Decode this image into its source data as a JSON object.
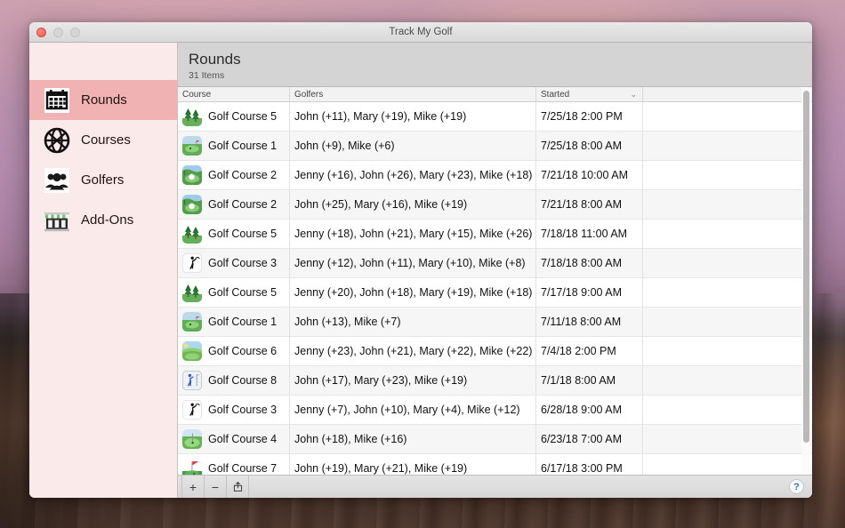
{
  "window": {
    "title": "Track My Golf",
    "traffic_lights": [
      "close",
      "minimize",
      "maximize"
    ]
  },
  "sidebar": {
    "items": [
      {
        "label": "Rounds",
        "icon": "calendar-icon",
        "selected": true
      },
      {
        "label": "Courses",
        "icon": "globe-icon",
        "selected": false
      },
      {
        "label": "Golfers",
        "icon": "people-icon",
        "selected": false
      },
      {
        "label": "Add-Ons",
        "icon": "store-icon",
        "selected": false
      }
    ]
  },
  "content": {
    "title": "Rounds",
    "subtitle": "31 Items"
  },
  "table": {
    "columns": [
      {
        "key": "course",
        "label": "Course",
        "sorted": false
      },
      {
        "key": "golfers",
        "label": "Golfers",
        "sorted": false
      },
      {
        "key": "started",
        "label": "Started",
        "sorted": true,
        "sort_indicator": "⌄"
      },
      {
        "key": "extra",
        "label": "",
        "sorted": false
      }
    ],
    "rows": [
      {
        "course": "Golf Course 5",
        "icon": "course-trees-icon",
        "golfers": "John (+11), Mary (+19), Mike (+19)",
        "started": "7/25/18 2:00 PM"
      },
      {
        "course": "Golf Course 1",
        "icon": "course-green-icon",
        "golfers": "John (+9), Mike (+6)",
        "started": "7/25/18 8:00 AM"
      },
      {
        "course": "Golf Course 2",
        "icon": "course-ball-icon",
        "golfers": "Jenny (+16), John (+26), Mary (+23), Mike (+18)",
        "started": "7/21/18 10:00 AM"
      },
      {
        "course": "Golf Course 2",
        "icon": "course-ball-icon",
        "golfers": "John (+25), Mary (+16), Mike (+19)",
        "started": "7/21/18 8:00 AM"
      },
      {
        "course": "Golf Course 5",
        "icon": "course-trees-icon",
        "golfers": "Jenny (+18), John (+21), Mary (+15), Mike (+26)",
        "started": "7/18/18 11:00 AM"
      },
      {
        "course": "Golf Course 3",
        "icon": "course-swing-icon",
        "golfers": "Jenny (+12), John (+11), Mary (+10), Mike (+8)",
        "started": "7/18/18 8:00 AM"
      },
      {
        "course": "Golf Course 5",
        "icon": "course-trees-icon",
        "golfers": "Jenny (+20), John (+18), Mary (+19), Mike (+18)",
        "started": "7/17/18 9:00 AM"
      },
      {
        "course": "Golf Course 1",
        "icon": "course-green-icon",
        "golfers": "John (+13), Mike (+7)",
        "started": "7/11/18 8:00 AM"
      },
      {
        "course": "Golf Course 6",
        "icon": "course-fairway-icon",
        "golfers": "Jenny (+23), John (+21), Mary (+22), Mike (+22)",
        "started": "7/4/18 2:00 PM"
      },
      {
        "course": "Golf Course 8",
        "icon": "course-golfer-icon",
        "golfers": "John (+17), Mary (+23), Mike (+19)",
        "started": "7/1/18 8:00 AM"
      },
      {
        "course": "Golf Course 3",
        "icon": "course-swing-icon",
        "golfers": "Jenny (+7), John (+10), Mary (+4), Mike (+12)",
        "started": "6/28/18 9:00 AM"
      },
      {
        "course": "Golf Course 4",
        "icon": "course-pin-icon",
        "golfers": "John (+18), Mike (+16)",
        "started": "6/23/18 7:00 AM"
      },
      {
        "course": "Golf Course 7",
        "icon": "course-flag-icon",
        "golfers": "John (+19), Mary (+21), Mike (+19)",
        "started": "6/17/18 3:00 PM"
      },
      {
        "course": "",
        "icon": "course-ball-icon",
        "golfers": "",
        "started": ""
      }
    ]
  },
  "toolbar": {
    "add_label": "+",
    "remove_label": "−",
    "share_label": "share-icon",
    "help_label": "?"
  }
}
